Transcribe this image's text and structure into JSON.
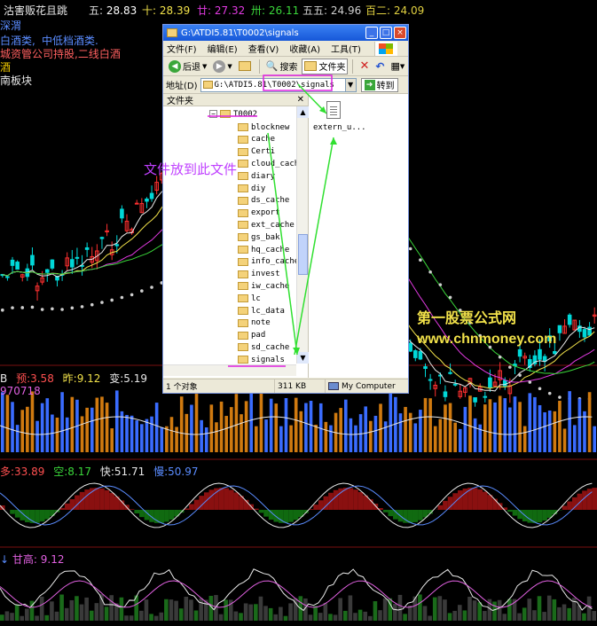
{
  "header": {
    "stock_name": "沽害贩花且跳",
    "items": [
      {
        "label": "五:",
        "value": "28.83",
        "color": "#e8e8e8"
      },
      {
        "label": "十:",
        "value": "28.39",
        "color": "#f2e24a"
      },
      {
        "label": "廿:",
        "value": "27.32",
        "color": "#e23ae2"
      },
      {
        "label": "卅:",
        "value": "26.11",
        "color": "#3ad63a"
      },
      {
        "label": "五五:",
        "value": "24.96",
        "color": "#cfcfcf"
      },
      {
        "label": "百二:",
        "value": "24.09",
        "color": "#e0d040"
      }
    ]
  },
  "left_notes": [
    {
      "text": "深渭",
      "color": "#5a8cff"
    },
    {
      "text": "白酒类,",
      "color": "#5a8cff"
    },
    {
      "text": "中低档酒类.",
      "color": "#5a8cff"
    },
    {
      "text": "城资管公司持股,二线白酒",
      "color": "#ff6060"
    },
    {
      "text": "酒",
      "color": "#f0c800"
    },
    {
      "text": "南板块",
      "color": "#e8e8e8"
    }
  ],
  "window": {
    "title": "G:\\ATDI5.81\\T0002\\signals",
    "menu": [
      "文件(F)",
      "编辑(E)",
      "查看(V)",
      "收藏(A)",
      "工具(T)",
      "帮助(H)"
    ],
    "toolbar": {
      "back": "后退",
      "search": "搜索",
      "folders": "文件夹"
    },
    "address_label": "地址(D)",
    "address_value": "G:\\ATDI5.81\\T0002\\signals",
    "go_label": "转到",
    "tree_header": "文件夹",
    "tree_root": "T0002",
    "tree_items": [
      "blocknew",
      "cache",
      "Certi",
      "cloud_cache",
      "diary",
      "diy",
      "ds_cache",
      "export",
      "ext_cache",
      "gs_bak",
      "hq_cache",
      "info_cache",
      "invest",
      "iw_cache",
      "lc",
      "lc_data",
      "note",
      "pad",
      "sd_cache",
      "signals"
    ],
    "file_name": "extern_u...",
    "status": {
      "count": "1 个对象",
      "size": "311 KB",
      "location": "My Computer"
    }
  },
  "annotations": {
    "instruction": "文件放到此文件",
    "site_name": "第一股票公式网",
    "site_url": "www.chnmoney.com"
  },
  "indicator1": {
    "items": [
      {
        "label": "预:",
        "value": "3.58",
        "color": "#ff5050"
      },
      {
        "label": "昨:",
        "value": "9.12",
        "color": "#f2e24a"
      },
      {
        "label": "变:",
        "value": "5.19",
        "color": "#e8e8e8"
      }
    ],
    "extra": "970718",
    "prefix": "B"
  },
  "indicator2": {
    "items": [
      {
        "label": "多:",
        "value": "33.89",
        "color": "#ff5050"
      },
      {
        "label": "空:",
        "value": "8.17",
        "color": "#3ad63a"
      },
      {
        "label": "快:",
        "value": "51.71",
        "color": "#e8e8e8"
      },
      {
        "label": "慢:",
        "value": "50.97",
        "color": "#5a8cff"
      }
    ]
  },
  "indicator3": {
    "label": "甘高:",
    "value": "9.12",
    "color": "#e060e0"
  },
  "colors": {
    "up": "#ff3030",
    "down": "#00d8d8",
    "vol_up": "#d07a10",
    "vol_down": "#3a6cff"
  }
}
